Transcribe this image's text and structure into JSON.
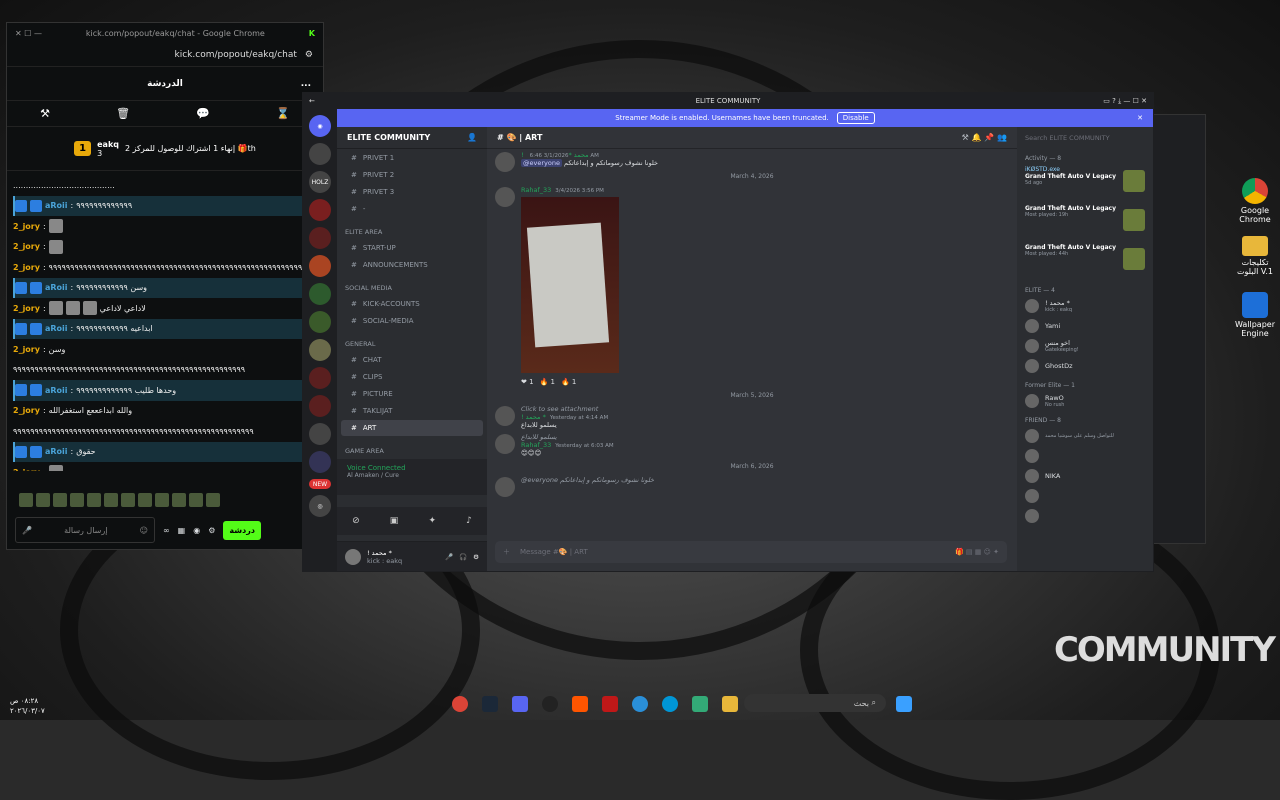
{
  "chrome": {
    "tab_title": "kick.com/popout/eakq/chat - Google Chrome",
    "url": "kick.com/popout/eakq/chat",
    "header": "الدردشة",
    "more": "...",
    "goal": {
      "level": "1",
      "streamer": "eakq",
      "count": "3",
      "text": "إنهاء 1 اشتراك للوصول للمركز 2 🎁th"
    },
    "messages": [
      {
        "user": "",
        "text": "........................................",
        "hl": false
      },
      {
        "user": "aRoii",
        "text": "٩٩٩٩٩٩٩٩٩٩٩٩٩",
        "hl": true
      },
      {
        "user": "2_jory",
        "text": "",
        "hl": false,
        "img": 1
      },
      {
        "user": "2_jory",
        "text": "",
        "hl": false,
        "img": 1
      },
      {
        "user": "2_jory",
        "text": "٩٩٩٩٩٩٩٩٩٩٩٩٩٩٩٩٩٩٩٩٩٩٩٩٩٩٩٩٩٩٩٩٩٩٩٩٩٩٩٩٩٩٩٩٩٩٩٩٩٩٩٩٩٩٩٩٩٩٩",
        "hl": false
      },
      {
        "user": "aRoii",
        "text": "وسن ٩٩٩٩٩٩٩٩٩٩٩٩",
        "hl": true
      },
      {
        "user": "2_jory",
        "text": "لاداعي لاداعي",
        "hl": false,
        "img": 3
      },
      {
        "user": "aRoii",
        "text": "ابداعيه ٩٩٩٩٩٩٩٩٩٩٩٩",
        "hl": true
      },
      {
        "user": "2_jory",
        "text": "وسن",
        "hl": false
      },
      {
        "user": "",
        "text": "٩٩٩٩٩٩٩٩٩٩٩٩٩٩٩٩٩٩٩٩٩٩٩٩٩٩٩٩٩٩٩٩٩٩٩٩٩٩٩٩٩٩٩٩٩٩٩٩٩٩٩٩٩٩",
        "hl": false
      },
      {
        "user": "aRoii",
        "text": "وحدها طليب ٩٩٩٩٩٩٩٩٩٩٩٩٩",
        "hl": true
      },
      {
        "user": "2_jory",
        "text": "والله ابداعععع استغفرالله",
        "hl": false
      },
      {
        "user": "",
        "text": "٩٩٩٩٩٩٩٩٩٩٩٩٩٩٩٩٩٩٩٩٩٩٩٩٩٩٩٩٩٩٩٩٩٩٩٩٩٩٩٩٩٩٩٩٩٩٩٩٩٩٩٩٩٩٩٩",
        "hl": false
      },
      {
        "user": "aRoii",
        "text": "حقوق",
        "hl": true
      },
      {
        "user": "2_jory",
        "text": "",
        "hl": false,
        "img": 1
      },
      {
        "user": "aRoii",
        "text": "!!!ههيي",
        "hl": true
      }
    ],
    "input_placeholder": "إرسال رسالة",
    "send": "دردشة"
  },
  "discord": {
    "title": "ELITE COMMUNITY",
    "banner": "Streamer Mode is enabled. Usernames have been truncated.",
    "disable": "Disable",
    "server": "ELITE COMMUNITY",
    "categories": [
      {
        "name": "",
        "channels": [
          "PRIVET 1",
          "PRIVET 2",
          "PRIVET 3",
          "-"
        ]
      },
      {
        "name": "ELITE AREA",
        "channels": [
          "START-UP",
          "ANNOUNCEMENTS"
        ]
      },
      {
        "name": "SOCIAL MEDIA",
        "channels": [
          "KICK-ACCOUNTS",
          "SOCIAL-MEDIA"
        ]
      },
      {
        "name": "GENERAL",
        "channels": [
          "CHAT",
          "CLIPS",
          "PICTURE",
          "TAKLIJAT",
          "ART"
        ]
      },
      {
        "name": "GAME AREA",
        "channels": [
          "GAMES"
        ]
      }
    ],
    "active_channel": "ART",
    "voice": {
      "status": "Voice Connected",
      "room": "Al Amaken / Cure"
    },
    "me": {
      "name": "! محمد *",
      "sub": "kick : eakq"
    },
    "channel_header": "ART",
    "messages": [
      {
        "date": "",
        "user": "! محمد *",
        "time": "3/1/2026 6:46 AM",
        "mention": "@everyone",
        "text": "خلونا نشوف رسوماتكم و إبداعاتكم"
      },
      {
        "date": "March 4, 2026",
        "user": "Rahaf_33",
        "time": "3/4/2026 3:56 PM",
        "image": true,
        "reactions": [
          "❤ 1",
          "🔥 1",
          "🔥 1"
        ]
      },
      {
        "date": "March 5, 2026",
        "reply": "Click to see attachment",
        "user": "! محمد *",
        "time": "Yesterday at 4:14 AM",
        "text": "يسلمو للابداع"
      },
      {
        "date": "",
        "reply": "يسلمو للابداع",
        "user": "Rahaf_33",
        "time": "Yesterday at 6:03 AM",
        "text": "😊😊😊"
      },
      {
        "date": "March 6, 2026",
        "reply": "@everyone خلونا نشوف رسوماتكم و إبداعاتكم",
        "user": "",
        "time": "",
        "text": ""
      }
    ],
    "composer": "Message #🎨 | ART",
    "search": "Search ELITE COMMUNITY",
    "activity": {
      "label": "Activity — 8",
      "items": [
        {
          "user": "iKØSTD.exe",
          "game": "Grand Theft Auto V Legacy",
          "sub": "5d ago"
        },
        {
          "user": "",
          "game": "Grand Theft Auto V Legacy",
          "sub": "Most played: 19h"
        },
        {
          "user": "",
          "game": "Grand Theft Auto V Legacy",
          "sub": "Most played: 44h"
        }
      ]
    },
    "groups": [
      {
        "label": "ELITE — 4",
        "members": [
          {
            "name": "! محمد *",
            "sub": "kick : eakq"
          },
          {
            "name": "Yami",
            "sub": ""
          },
          {
            "name": "اخو منس",
            "sub": "Gatekeeping!"
          },
          {
            "name": "GhostDz",
            "sub": ""
          }
        ]
      },
      {
        "label": "Former Elite — 1",
        "members": [
          {
            "name": "RawO",
            "sub": "No rush"
          }
        ]
      },
      {
        "label": "FRIEND — 8",
        "members": [
          {
            "name": "",
            "sub": "للتواصل وسلم على سوشيا محمد"
          },
          {
            "name": "",
            "sub": ""
          },
          {
            "name": "NIKA",
            "sub": ""
          },
          {
            "name": "",
            "sub": ""
          },
          {
            "name": "",
            "sub": ""
          }
        ]
      }
    ]
  },
  "desktop": {
    "icons": [
      "Google Chrome",
      "تكليجات البلوت V.1",
      "Wallpaper Engine"
    ],
    "search": "بحث",
    "clock": [
      "٠٨:٢٨ ص",
      "٢٠٢٦/٠٣/٠٧"
    ],
    "watermark": "COMMUNITY"
  }
}
